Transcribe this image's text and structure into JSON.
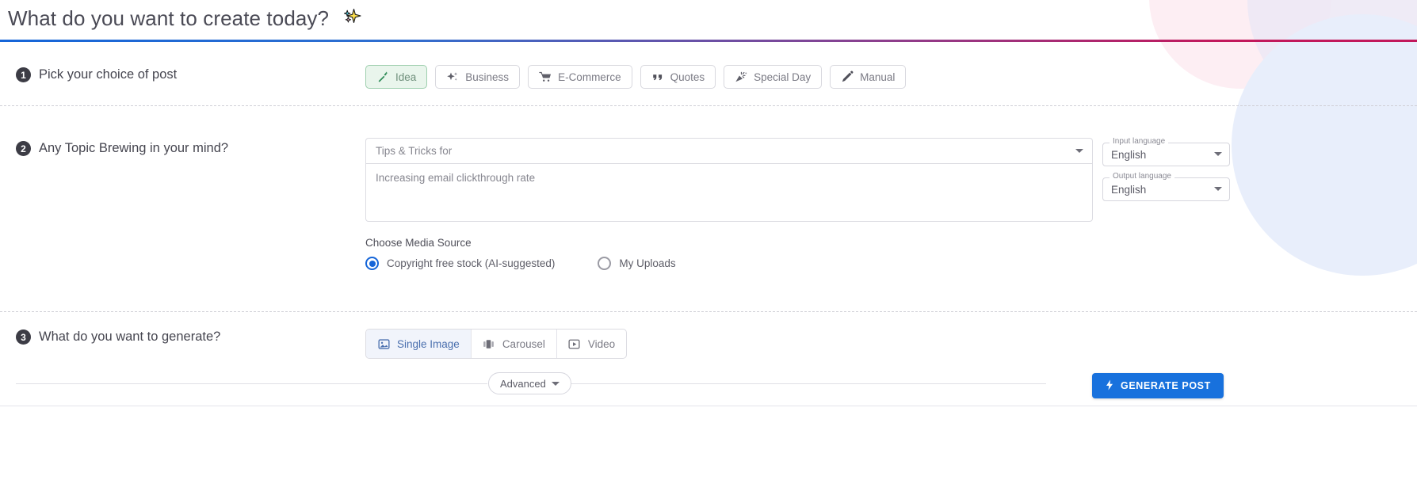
{
  "header": {
    "title": "What do you want to create today?",
    "sparkle_icon": "sparkles-icon"
  },
  "step1": {
    "number": "1",
    "label": "Pick your choice of post",
    "options": [
      {
        "label": "Idea",
        "icon": "magic-wand-icon",
        "selected": true
      },
      {
        "label": "Business",
        "icon": "sparkle-icon",
        "selected": false
      },
      {
        "label": "E-Commerce",
        "icon": "shopping-cart-icon",
        "selected": false
      },
      {
        "label": "Quotes",
        "icon": "quote-marks-icon",
        "selected": false
      },
      {
        "label": "Special Day",
        "icon": "party-popper-icon",
        "selected": false
      },
      {
        "label": "Manual",
        "icon": "pencil-icon",
        "selected": false
      }
    ]
  },
  "step2": {
    "number": "2",
    "label": "Any Topic Brewing in your mind?",
    "topic_select_value": "Tips & Tricks for",
    "topic_textarea_value": "Increasing email clickthrough rate",
    "input_language": {
      "legend": "Input language",
      "value": "English"
    },
    "output_language": {
      "legend": "Output language",
      "value": "English"
    },
    "media_source_title": "Choose Media Source",
    "media_options": [
      {
        "label": "Copyright free stock (AI-suggested)",
        "selected": true
      },
      {
        "label": "My Uploads",
        "selected": false
      }
    ]
  },
  "step3": {
    "number": "3",
    "label": "What do you want to generate?",
    "types": [
      {
        "label": "Single Image",
        "icon": "image-icon",
        "active": true
      },
      {
        "label": "Carousel",
        "icon": "carousel-icon",
        "active": false
      },
      {
        "label": "Video",
        "icon": "play-box-icon",
        "active": false
      }
    ]
  },
  "footer": {
    "advanced_label": "Advanced",
    "advanced_icon": "chevron-down-icon",
    "generate_label": "GENERATE POST",
    "generate_icon": "bolt-icon"
  },
  "colors": {
    "accent_blue": "#1871dd",
    "rule_start": "#1565d8",
    "rule_end": "#c2185b",
    "selected_chip_bg": "#e9f5ec",
    "selected_chip_border": "#9ecfae",
    "radio_on": "#1565d8"
  }
}
